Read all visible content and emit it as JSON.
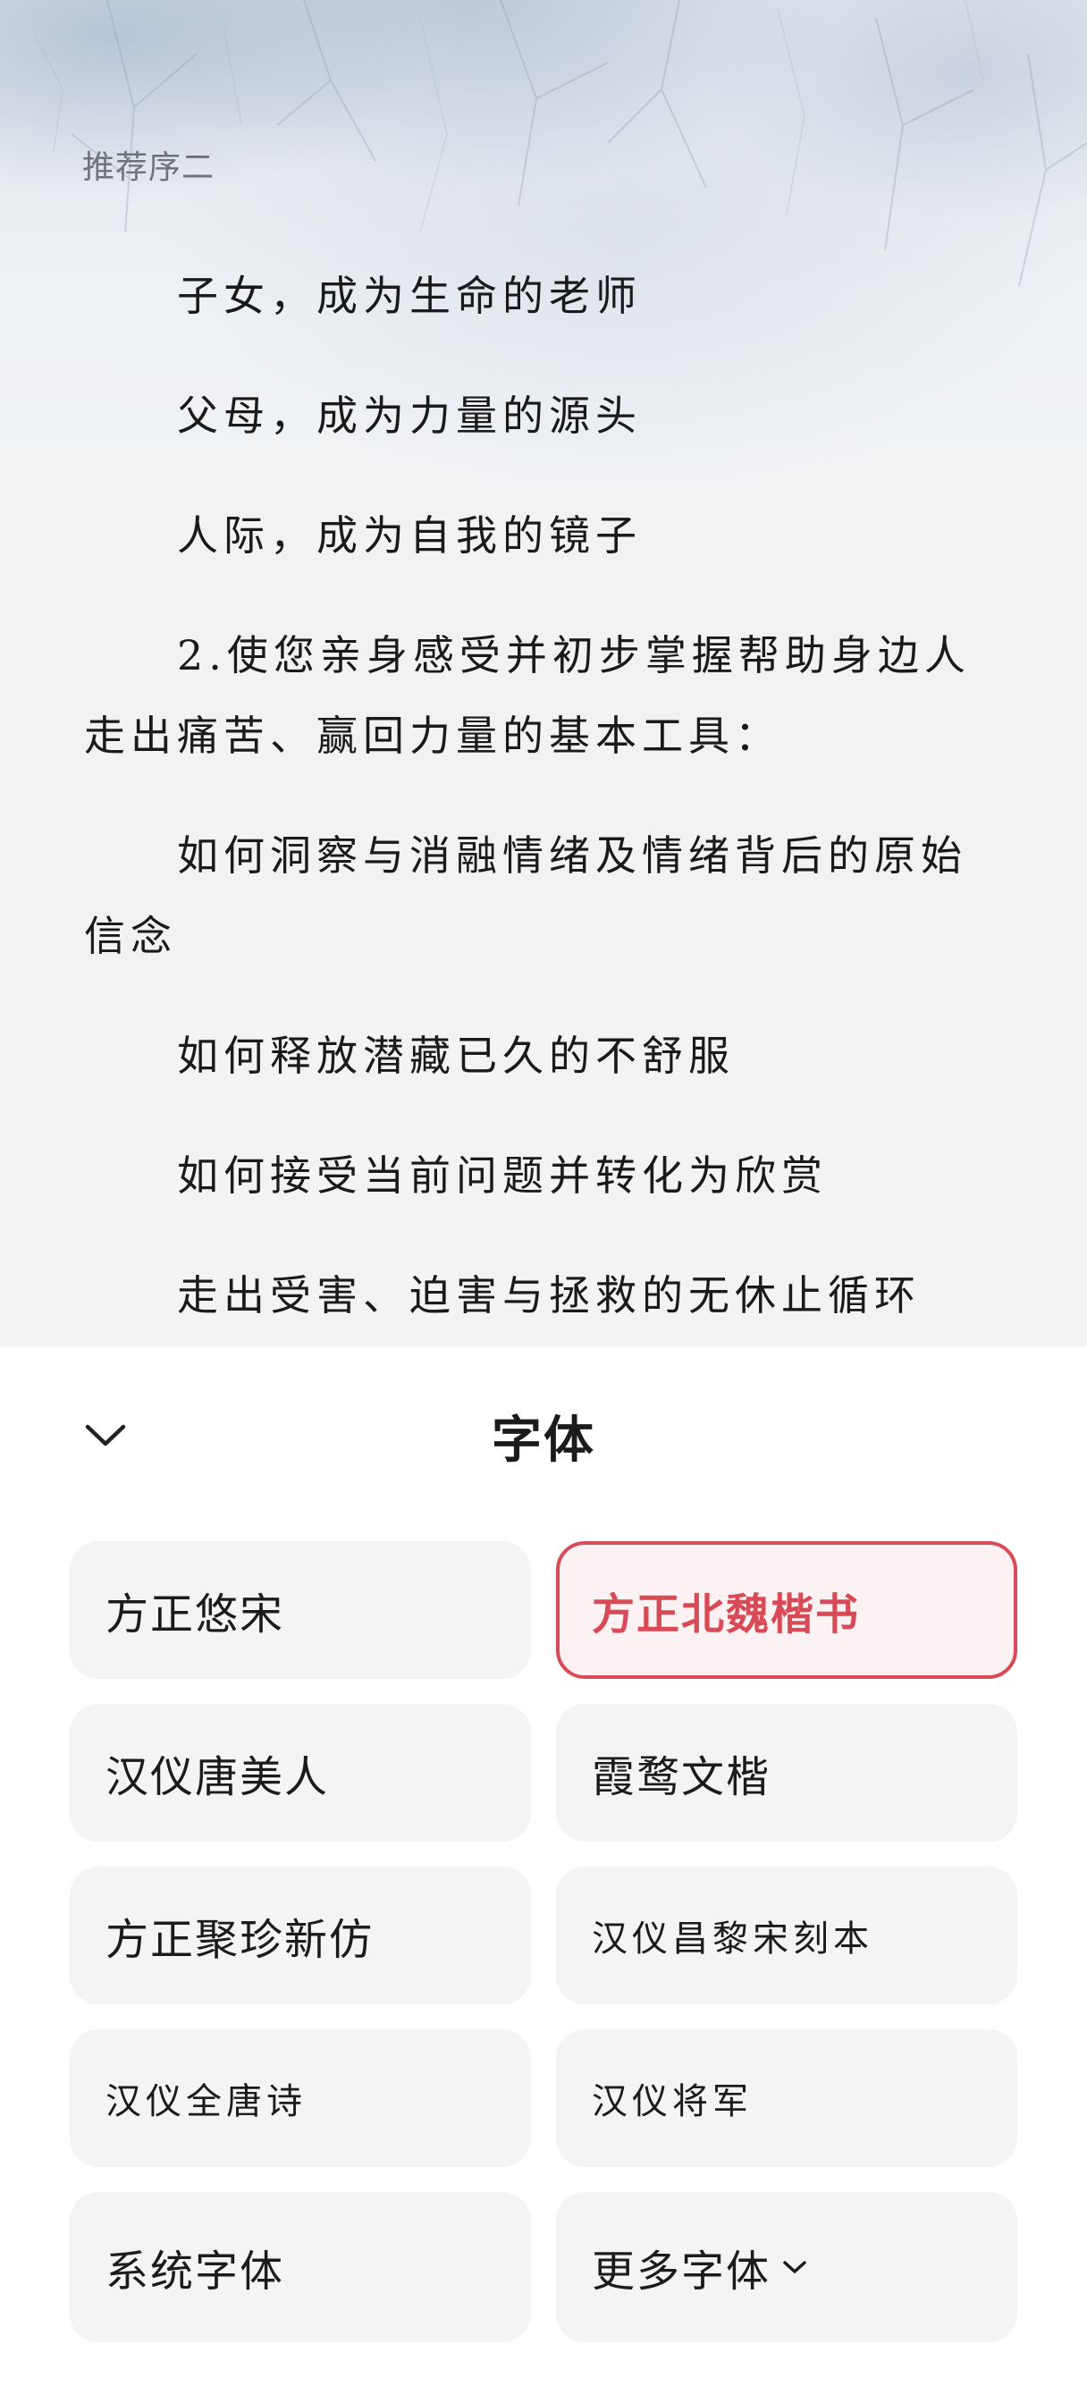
{
  "reader": {
    "chapter_title": "推荐序二",
    "paragraphs": [
      "子女，成为生命的老师",
      "父母，成为力量的源头",
      "人际，成为自我的镜子",
      "2.使您亲身感受并初步掌握帮助身边人走出痛苦、赢回力量的基本工具：",
      "如何洞察与消融情绪及情绪背后的原始信念",
      "如何释放潜藏已久的不舒服",
      "如何接受当前问题并转化为欣赏",
      "走出受害、迫害与拯救的无休止循环"
    ]
  },
  "panel": {
    "title": "字体",
    "collapse_icon": "chevron-down-icon",
    "fonts": [
      {
        "label": "方正悠宋",
        "selected": false
      },
      {
        "label": "方正北魏楷书",
        "selected": true
      },
      {
        "label": "汉仪唐美人",
        "selected": false
      },
      {
        "label": "霞鹜文楷",
        "selected": false
      },
      {
        "label": "方正聚珍新仿",
        "selected": false
      },
      {
        "label": "汉仪昌黎宋刻本",
        "selected": false
      },
      {
        "label": "汉仪全唐诗",
        "selected": false
      },
      {
        "label": "汉仪将军",
        "selected": false
      },
      {
        "label": "系统字体",
        "selected": false
      },
      {
        "label": "更多字体",
        "selected": false
      }
    ]
  },
  "colors": {
    "accent": "#d84a55",
    "card_bg": "#f4f4f5",
    "selected_bg": "#fdf2f3"
  }
}
